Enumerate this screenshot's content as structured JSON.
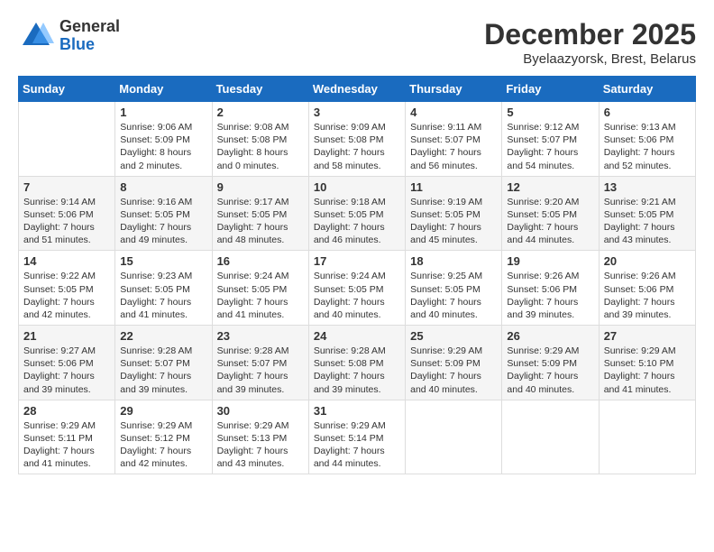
{
  "header": {
    "logo": {
      "general": "General",
      "blue": "Blue"
    },
    "title": "December 2025",
    "subtitle": "Byelaazyorsk, Brest, Belarus"
  },
  "days_of_week": [
    "Sunday",
    "Monday",
    "Tuesday",
    "Wednesday",
    "Thursday",
    "Friday",
    "Saturday"
  ],
  "weeks": [
    [
      {
        "day": "",
        "info": ""
      },
      {
        "day": "1",
        "info": "Sunrise: 9:06 AM\nSunset: 5:09 PM\nDaylight: 8 hours\nand 2 minutes."
      },
      {
        "day": "2",
        "info": "Sunrise: 9:08 AM\nSunset: 5:08 PM\nDaylight: 8 hours\nand 0 minutes."
      },
      {
        "day": "3",
        "info": "Sunrise: 9:09 AM\nSunset: 5:08 PM\nDaylight: 7 hours\nand 58 minutes."
      },
      {
        "day": "4",
        "info": "Sunrise: 9:11 AM\nSunset: 5:07 PM\nDaylight: 7 hours\nand 56 minutes."
      },
      {
        "day": "5",
        "info": "Sunrise: 9:12 AM\nSunset: 5:07 PM\nDaylight: 7 hours\nand 54 minutes."
      },
      {
        "day": "6",
        "info": "Sunrise: 9:13 AM\nSunset: 5:06 PM\nDaylight: 7 hours\nand 52 minutes."
      }
    ],
    [
      {
        "day": "7",
        "info": "Sunrise: 9:14 AM\nSunset: 5:06 PM\nDaylight: 7 hours\nand 51 minutes."
      },
      {
        "day": "8",
        "info": "Sunrise: 9:16 AM\nSunset: 5:05 PM\nDaylight: 7 hours\nand 49 minutes."
      },
      {
        "day": "9",
        "info": "Sunrise: 9:17 AM\nSunset: 5:05 PM\nDaylight: 7 hours\nand 48 minutes."
      },
      {
        "day": "10",
        "info": "Sunrise: 9:18 AM\nSunset: 5:05 PM\nDaylight: 7 hours\nand 46 minutes."
      },
      {
        "day": "11",
        "info": "Sunrise: 9:19 AM\nSunset: 5:05 PM\nDaylight: 7 hours\nand 45 minutes."
      },
      {
        "day": "12",
        "info": "Sunrise: 9:20 AM\nSunset: 5:05 PM\nDaylight: 7 hours\nand 44 minutes."
      },
      {
        "day": "13",
        "info": "Sunrise: 9:21 AM\nSunset: 5:05 PM\nDaylight: 7 hours\nand 43 minutes."
      }
    ],
    [
      {
        "day": "14",
        "info": "Sunrise: 9:22 AM\nSunset: 5:05 PM\nDaylight: 7 hours\nand 42 minutes."
      },
      {
        "day": "15",
        "info": "Sunrise: 9:23 AM\nSunset: 5:05 PM\nDaylight: 7 hours\nand 41 minutes."
      },
      {
        "day": "16",
        "info": "Sunrise: 9:24 AM\nSunset: 5:05 PM\nDaylight: 7 hours\nand 41 minutes."
      },
      {
        "day": "17",
        "info": "Sunrise: 9:24 AM\nSunset: 5:05 PM\nDaylight: 7 hours\nand 40 minutes."
      },
      {
        "day": "18",
        "info": "Sunrise: 9:25 AM\nSunset: 5:05 PM\nDaylight: 7 hours\nand 40 minutes."
      },
      {
        "day": "19",
        "info": "Sunrise: 9:26 AM\nSunset: 5:06 PM\nDaylight: 7 hours\nand 39 minutes."
      },
      {
        "day": "20",
        "info": "Sunrise: 9:26 AM\nSunset: 5:06 PM\nDaylight: 7 hours\nand 39 minutes."
      }
    ],
    [
      {
        "day": "21",
        "info": "Sunrise: 9:27 AM\nSunset: 5:06 PM\nDaylight: 7 hours\nand 39 minutes."
      },
      {
        "day": "22",
        "info": "Sunrise: 9:28 AM\nSunset: 5:07 PM\nDaylight: 7 hours\nand 39 minutes."
      },
      {
        "day": "23",
        "info": "Sunrise: 9:28 AM\nSunset: 5:07 PM\nDaylight: 7 hours\nand 39 minutes."
      },
      {
        "day": "24",
        "info": "Sunrise: 9:28 AM\nSunset: 5:08 PM\nDaylight: 7 hours\nand 39 minutes."
      },
      {
        "day": "25",
        "info": "Sunrise: 9:29 AM\nSunset: 5:09 PM\nDaylight: 7 hours\nand 40 minutes."
      },
      {
        "day": "26",
        "info": "Sunrise: 9:29 AM\nSunset: 5:09 PM\nDaylight: 7 hours\nand 40 minutes."
      },
      {
        "day": "27",
        "info": "Sunrise: 9:29 AM\nSunset: 5:10 PM\nDaylight: 7 hours\nand 41 minutes."
      }
    ],
    [
      {
        "day": "28",
        "info": "Sunrise: 9:29 AM\nSunset: 5:11 PM\nDaylight: 7 hours\nand 41 minutes."
      },
      {
        "day": "29",
        "info": "Sunrise: 9:29 AM\nSunset: 5:12 PM\nDaylight: 7 hours\nand 42 minutes."
      },
      {
        "day": "30",
        "info": "Sunrise: 9:29 AM\nSunset: 5:13 PM\nDaylight: 7 hours\nand 43 minutes."
      },
      {
        "day": "31",
        "info": "Sunrise: 9:29 AM\nSunset: 5:14 PM\nDaylight: 7 hours\nand 44 minutes."
      },
      {
        "day": "",
        "info": ""
      },
      {
        "day": "",
        "info": ""
      },
      {
        "day": "",
        "info": ""
      }
    ]
  ]
}
